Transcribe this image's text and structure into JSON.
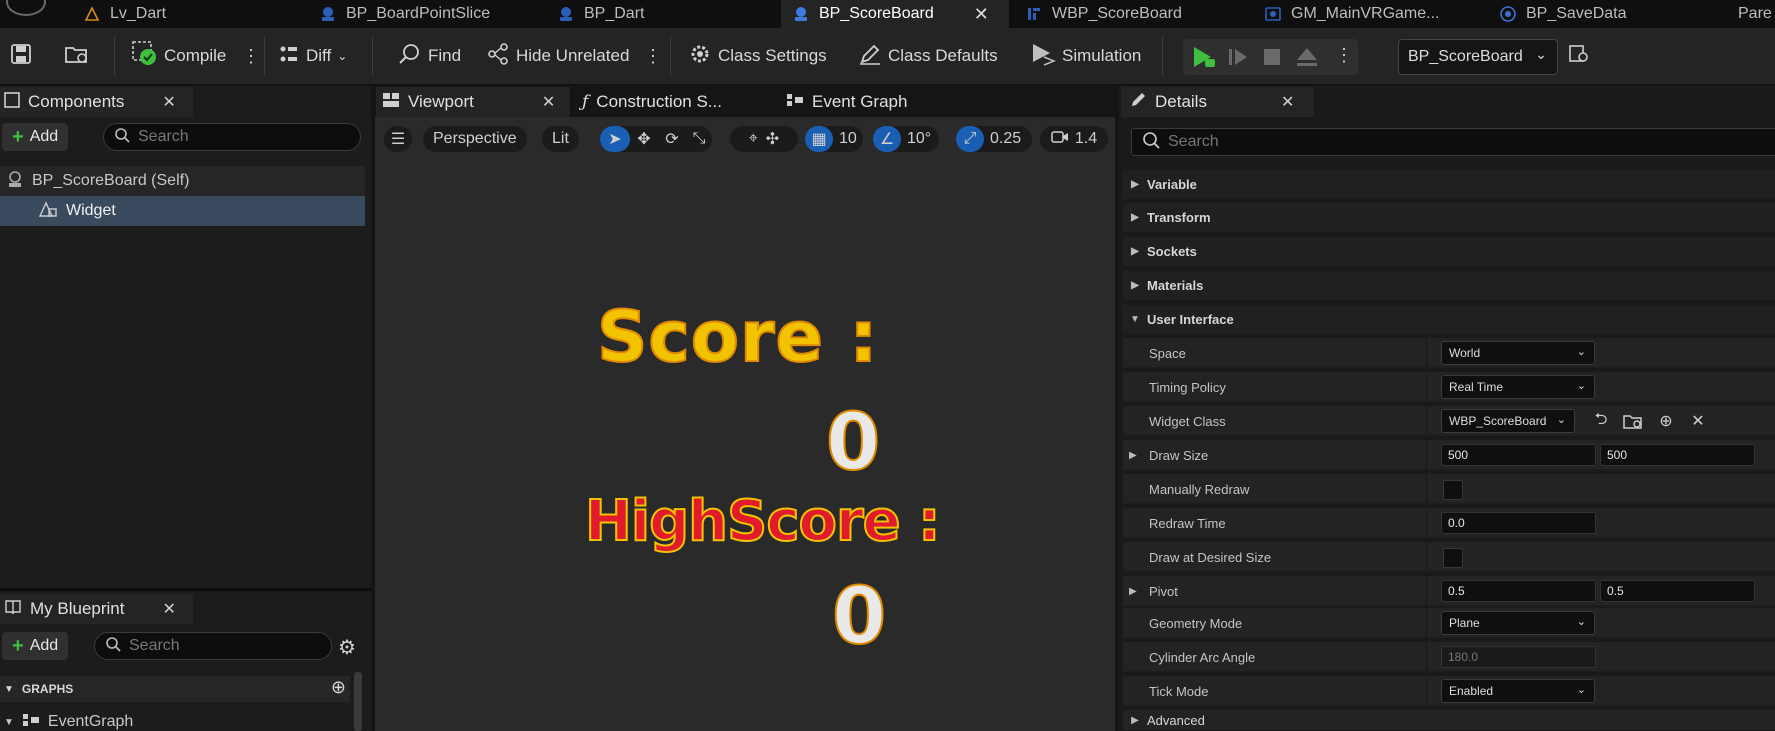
{
  "tabs": [
    {
      "label": "Lv_Dart",
      "icon": "level-icon"
    },
    {
      "label": "BP_BoardPointSlice",
      "icon": "blueprint-icon"
    },
    {
      "label": "BP_Dart",
      "icon": "blueprint-icon"
    },
    {
      "label": "BP_ScoreBoard",
      "icon": "blueprint-icon",
      "active": true
    },
    {
      "label": "WBP_ScoreBoard",
      "icon": "widget-blueprint-icon"
    },
    {
      "label": "GM_MainVRGame...",
      "icon": "gamemode-icon"
    },
    {
      "label": "BP_SaveData",
      "icon": "savegame-icon"
    },
    {
      "label": "Pare",
      "icon": ""
    }
  ],
  "toolbar": {
    "compile": "Compile",
    "diff": "Diff",
    "find": "Find",
    "hide_unrelated": "Hide Unrelated",
    "class_settings": "Class Settings",
    "class_defaults": "Class Defaults",
    "simulation": "Simulation",
    "debug_object": "BP_ScoreBoard"
  },
  "components": {
    "title": "Components",
    "add_label": "Add",
    "search_placeholder": "Search",
    "items": [
      {
        "label": "BP_ScoreBoard (Self)"
      },
      {
        "label": "Widget"
      }
    ]
  },
  "my_blueprint": {
    "title": "My Blueprint",
    "add_label": "Add",
    "search_placeholder": "Search",
    "section": "GRAPHS",
    "items": [
      {
        "label": "EventGraph"
      }
    ]
  },
  "editor_tabs": [
    {
      "label": "Viewport"
    },
    {
      "label": "Construction S..."
    },
    {
      "label": "Event Graph"
    }
  ],
  "viewport": {
    "perspective": "Perspective",
    "lit": "Lit",
    "grid_snap": "10",
    "rotation_snap": "10°",
    "scale_snap": "0.25",
    "camera_speed": "1.4",
    "score_label": "Score :",
    "score_value": "0",
    "highscore_label": "HighScore :",
    "highscore_value": "0"
  },
  "details": {
    "title": "Details",
    "search_placeholder": "Search",
    "categories": [
      "Variable",
      "Transform",
      "Sockets",
      "Materials",
      "User Interface"
    ],
    "rows": {
      "space": {
        "label": "Space",
        "value": "World"
      },
      "timing_policy": {
        "label": "Timing Policy",
        "value": "Real Time"
      },
      "widget_class": {
        "label": "Widget Class",
        "value": "WBP_ScoreBoard"
      },
      "draw_size": {
        "label": "Draw Size",
        "x": "500",
        "y": "500"
      },
      "manually_redraw": {
        "label": "Manually Redraw"
      },
      "redraw_time": {
        "label": "Redraw Time",
        "value": "0.0"
      },
      "draw_desired": {
        "label": "Draw at Desired Size"
      },
      "pivot": {
        "label": "Pivot",
        "x": "0.5",
        "y": "0.5"
      },
      "geometry_mode": {
        "label": "Geometry Mode",
        "value": "Plane"
      },
      "cylinder_arc": {
        "label": "Cylinder Arc Angle",
        "value": "180.0"
      },
      "tick_mode": {
        "label": "Tick Mode",
        "value": "Enabled"
      }
    },
    "advanced": "Advanced"
  },
  "colors": {
    "accent_blue": "#1a5fb4",
    "play_green": "#3fbf3f",
    "score_yellow": "#f2c400",
    "highscore_red": "#e21b2c"
  }
}
